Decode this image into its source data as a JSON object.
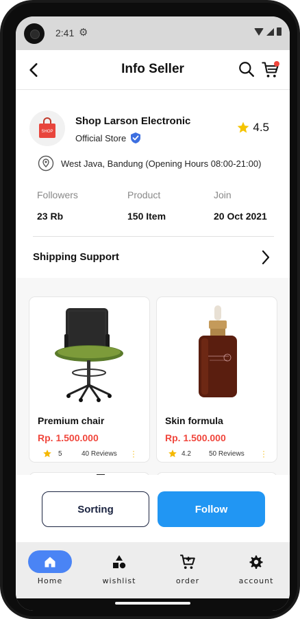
{
  "status_bar": {
    "time": "2:41"
  },
  "header": {
    "title": "Info Seller"
  },
  "seller": {
    "logo_text": "SHOP",
    "name": "Shop Larson Electronic",
    "badge": "Official Store",
    "rating": "4.5",
    "location": "West Java, Bandung (Opening Hours 08:00-21:00)"
  },
  "stats": [
    {
      "label": "Followers",
      "value": "23 Rb"
    },
    {
      "label": "Product",
      "value": "150 Item"
    },
    {
      "label": "Join",
      "value": "20 Oct 2021"
    }
  ],
  "shipping": {
    "label": "Shipping Support"
  },
  "products": [
    {
      "name": "Premium chair",
      "price": "Rp. 1.500.000",
      "rating": "5",
      "reviews": "40 Reviews"
    },
    {
      "name": "Skin formula",
      "price": "Rp. 1.500.000",
      "rating": "4.2",
      "reviews": "50 Reviews"
    }
  ],
  "actions": {
    "sorting": "Sorting",
    "follow": "Follow"
  },
  "nav": [
    {
      "label": "Home",
      "icon": "home-icon",
      "active": true
    },
    {
      "label": "wishlist",
      "icon": "shapes-icon",
      "active": false
    },
    {
      "label": "order",
      "icon": "cart-add-icon",
      "active": false
    },
    {
      "label": "account",
      "icon": "gear-icon",
      "active": false
    }
  ],
  "colors": {
    "accent": "#2196f3",
    "nav_active": "#4a84f5",
    "price": "#f0463c",
    "star": "#f5b800",
    "verified": "#3d6fe0"
  }
}
